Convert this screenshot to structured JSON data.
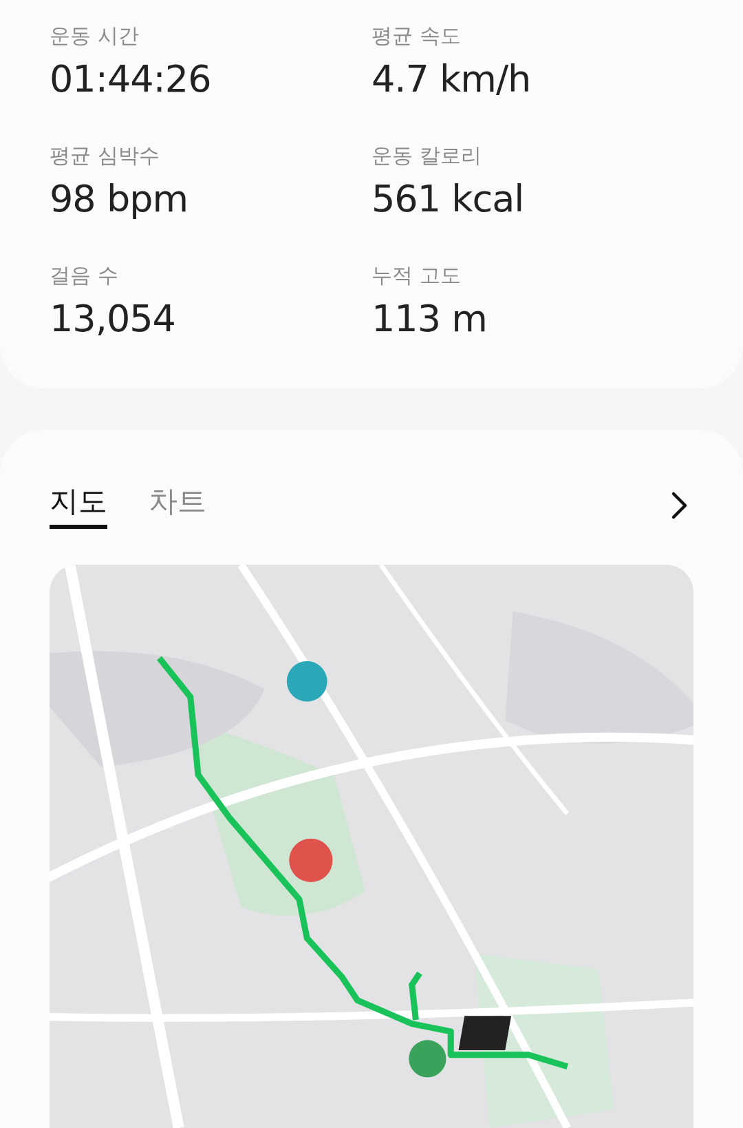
{
  "stats": [
    {
      "label": "운동 시간",
      "value": "01:44:26"
    },
    {
      "label": "평균 속도",
      "value": "4.7 km/h"
    },
    {
      "label": "평균 심박수",
      "value": "98 bpm"
    },
    {
      "label": "운동 칼로리",
      "value": "561 kcal"
    },
    {
      "label": "걸음 수",
      "value": "13,054"
    },
    {
      "label": "누적 고도",
      "value": "113 m"
    }
  ],
  "tabs": [
    {
      "label": "지도",
      "selected": true
    },
    {
      "label": "차트",
      "selected": false
    }
  ]
}
